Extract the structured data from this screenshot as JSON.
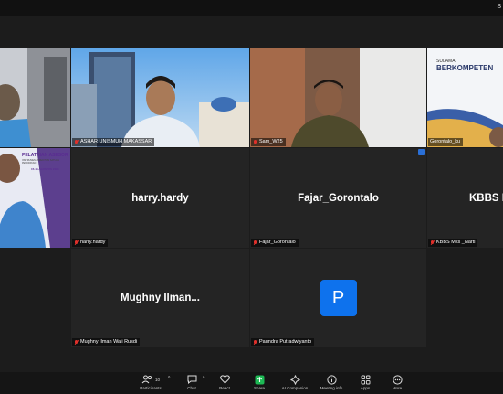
{
  "topbar": {
    "right_text": "S"
  },
  "tiles": {
    "t1": {
      "name": ""
    },
    "t2": {
      "name": "ASHAR UNISMUH MAKASSAR"
    },
    "t3": {
      "name": "Sam_W25"
    },
    "t4": {
      "name": "Gorontalo_ku",
      "poster_line1": "SULAMA",
      "poster_line2": "BERKOMPETEN"
    },
    "t5": {
      "name": "",
      "poster_title": "PELATIHAN ASESOR",
      "poster_sub": "INSTRUMEN AKREDITASI SATUAN PENDIDIKAN",
      "poster_date": "15-16 AGUSTUS 2025"
    },
    "t6": {
      "display": "harry.hardy",
      "name": "harry.hardy"
    },
    "t7": {
      "display": "Fajar_Gorontalo",
      "name": "Fajar_Gorontalo"
    },
    "t8": {
      "display": "KBBS M",
      "name": "KBBS Mks _Narti"
    },
    "t9": {
      "display": "Mughny Ilman...",
      "name": "Mughny Ilman Wali Rusdi"
    },
    "t10": {
      "initial": "P",
      "name": "Paundra Putradwiyanto"
    }
  },
  "toolbar": {
    "participants": "Participants",
    "participants_count": "10",
    "chat": "Chat",
    "react": "React",
    "share": "Share",
    "ai": "AI Companion",
    "meeting_info": "Meeting info",
    "apps": "Apps",
    "more": "More"
  },
  "colors": {
    "active_border": "#23d959",
    "avatar_bg": "#0e72ed",
    "share_green": "#1db954",
    "muted_red": "#e0302b"
  }
}
